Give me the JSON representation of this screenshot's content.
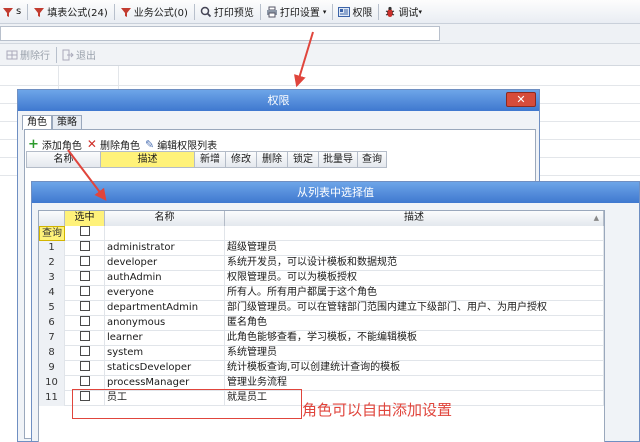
{
  "toolbar": {
    "fill_formula": "填表公式(24)",
    "business_formula": "业务公式(0)",
    "print_preview": "打印预览",
    "print_settings": "打印设置",
    "permissions": "权限",
    "debug": "调试"
  },
  "toolbar2": {
    "delete_row": "删除行",
    "exit": "退出"
  },
  "permissions_window": {
    "title": "权限",
    "tabs": [
      "角色",
      "策略"
    ],
    "add_role": "添加角色",
    "delete_role": "删除角色",
    "edit_permission_list": "编辑权限列表",
    "columns": [
      "名称",
      "描述",
      "新增",
      "修改",
      "删除",
      "锁定",
      "批量导",
      "查询"
    ]
  },
  "picker_window": {
    "title": "从列表中选择值",
    "columns": {
      "selected": "选中",
      "name": "名称",
      "description": "描述"
    },
    "filter_label": "查询",
    "rows": [
      {
        "num": "1",
        "name": "administrator",
        "desc": "超级管理员"
      },
      {
        "num": "2",
        "name": "developer",
        "desc": "系统开发员，可以设计模板和数据规范"
      },
      {
        "num": "3",
        "name": "authAdmin",
        "desc": "权限管理员。可以为模板授权"
      },
      {
        "num": "4",
        "name": "everyone",
        "desc": "所有人。所有用户都属于这个角色"
      },
      {
        "num": "5",
        "name": "departmentAdmin",
        "desc": "部门级管理员。可以在管辖部门范围内建立下级部门、用户、为用户授权"
      },
      {
        "num": "6",
        "name": "anonymous",
        "desc": "匿名角色"
      },
      {
        "num": "7",
        "name": "learner",
        "desc": "此角色能够查看，学习模板，不能编辑模板"
      },
      {
        "num": "8",
        "name": "system",
        "desc": "系统管理员"
      },
      {
        "num": "9",
        "name": "staticsDeveloper",
        "desc": "统计模板查询,可以创建统计查询的模板"
      },
      {
        "num": "10",
        "name": "processManager",
        "desc": "管理业务流程"
      },
      {
        "num": "11",
        "name": "员工",
        "desc": "就是员工"
      }
    ]
  },
  "annotation": "角色可以自由添加设置",
  "colors": {
    "accent_red": "#e0453c",
    "title_blue": "#4a86dc",
    "highlight": "#fff27a"
  }
}
